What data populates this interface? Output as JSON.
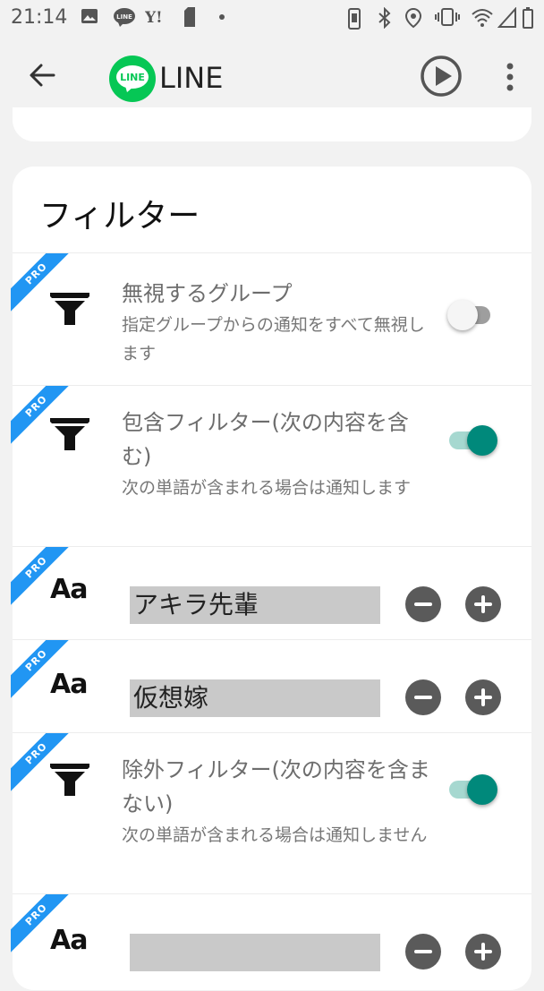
{
  "status_bar": {
    "time": "21:14",
    "icons": [
      "image-icon",
      "line-notification-icon",
      "yahoo-icon",
      "sim-icon",
      "dot-icon",
      "phone-icon",
      "bluetooth-icon",
      "location-icon",
      "vibrate-icon",
      "wifi-icon",
      "signal-icon",
      "battery-icon"
    ]
  },
  "app_bar": {
    "title": "LINE",
    "logo_text": "LINE",
    "back_icon": "arrow-left-icon",
    "play_icon": "play-circle-icon",
    "more_icon": "more-vert-icon"
  },
  "card": {
    "title": "フィルター",
    "pro_label": "PRO",
    "rows": [
      {
        "type": "filter",
        "title": "無視するグループ",
        "desc": "指定グループからの通知をすべて無視します",
        "toggle": "off"
      },
      {
        "type": "filter",
        "title": "包含フィルター(次の内容を含む)",
        "desc": "次の単語が含まれる場合は通知します",
        "toggle": "on"
      },
      {
        "type": "word",
        "icon_text": "Aa",
        "value": "アキラ先輩"
      },
      {
        "type": "word",
        "icon_text": "Aa",
        "value": "仮想嫁"
      },
      {
        "type": "filter",
        "title": "除外フィルター(次の内容を含まない)",
        "desc": "次の単語が含まれる場合は通知しません",
        "toggle": "on"
      },
      {
        "type": "word",
        "icon_text": "Aa",
        "value": ""
      }
    ]
  },
  "colors": {
    "accent": "#00897b",
    "accent_track": "#a6d8d0",
    "pro_badge": "#2196f3",
    "line_green": "#06c755",
    "background": "#f2f2f2"
  }
}
